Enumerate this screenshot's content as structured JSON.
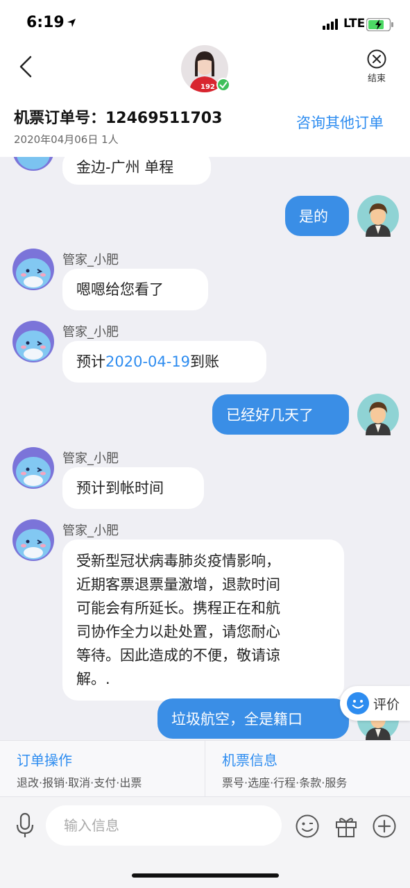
{
  "status_bar": {
    "time": "6:19",
    "network": "LTE"
  },
  "header": {
    "end_label": "结束",
    "order_number": "机票订单号：12469511703",
    "order_date": "2020年04月06日 1人",
    "other_orders": "咨询其他订单"
  },
  "messages": [
    {
      "type": "in",
      "text": "金边-广州 单程"
    },
    {
      "type": "out",
      "text": "是的"
    },
    {
      "type": "in",
      "sender": "管家_小肥",
      "text": "嗯嗯给您看了"
    },
    {
      "type": "in",
      "sender": "管家_小肥",
      "text_before": "预计",
      "link": "2020-04-19",
      "text_after": "到账"
    },
    {
      "type": "out",
      "text": "已经好几天了"
    },
    {
      "type": "in",
      "sender": "管家_小肥",
      "text": "预计到帐时间"
    },
    {
      "type": "in",
      "sender": "管家_小肥",
      "lines": [
        "受新型冠状病毒肺炎疫情影响，",
        "近期客票退票量激增，退款时间",
        "可能会有所延长。携程正在和航",
        "司协作全力以赴处置，请您耐心",
        "等待。因此造成的不便，敬请谅",
        "解。."
      ]
    },
    {
      "type": "out",
      "text": "垃圾航空，全是籍口"
    }
  ],
  "rate_button": "评价",
  "ops": {
    "order_ops": {
      "title": "订单操作",
      "items": "退改·报销·取消·支付·出票"
    },
    "ticket_info": {
      "title": "机票信息",
      "items": "票号·选座·行程·条款·服务"
    }
  },
  "input": {
    "placeholder": "输入信息"
  },
  "colors": {
    "accent": "#2d8cf0",
    "out_bubble": "#3a8ee6",
    "background": "#efeff4"
  }
}
